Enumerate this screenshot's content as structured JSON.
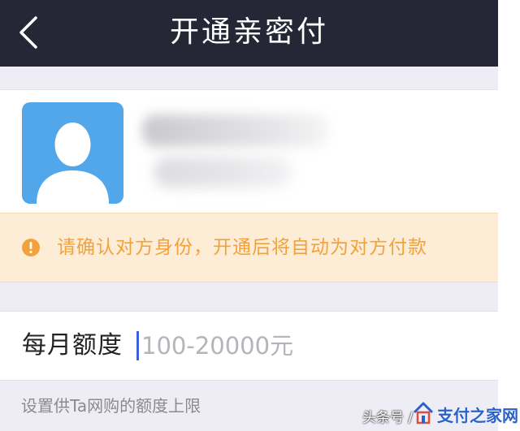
{
  "header": {
    "title": "开通亲密付",
    "back_icon": "chevron-left-icon"
  },
  "profile": {
    "avatar_icon": "user-avatar-icon",
    "avatar_color": "#52a6ea"
  },
  "notice": {
    "icon": "exclamation-circle-icon",
    "text": "请确认对方身份，开通后将自动为对方付款",
    "color": "#f2a23c",
    "background": "#fdedd6"
  },
  "amount": {
    "label": "每月额度",
    "placeholder": "100-20000元",
    "value": ""
  },
  "hint": "设置供Ta网购的额度上限",
  "watermark": {
    "prefix": "头条号 / ",
    "brand": "支付之家网"
  },
  "colors": {
    "navbar": "#252736",
    "page_background": "#eeedf6",
    "caret": "#3b5fe0"
  }
}
